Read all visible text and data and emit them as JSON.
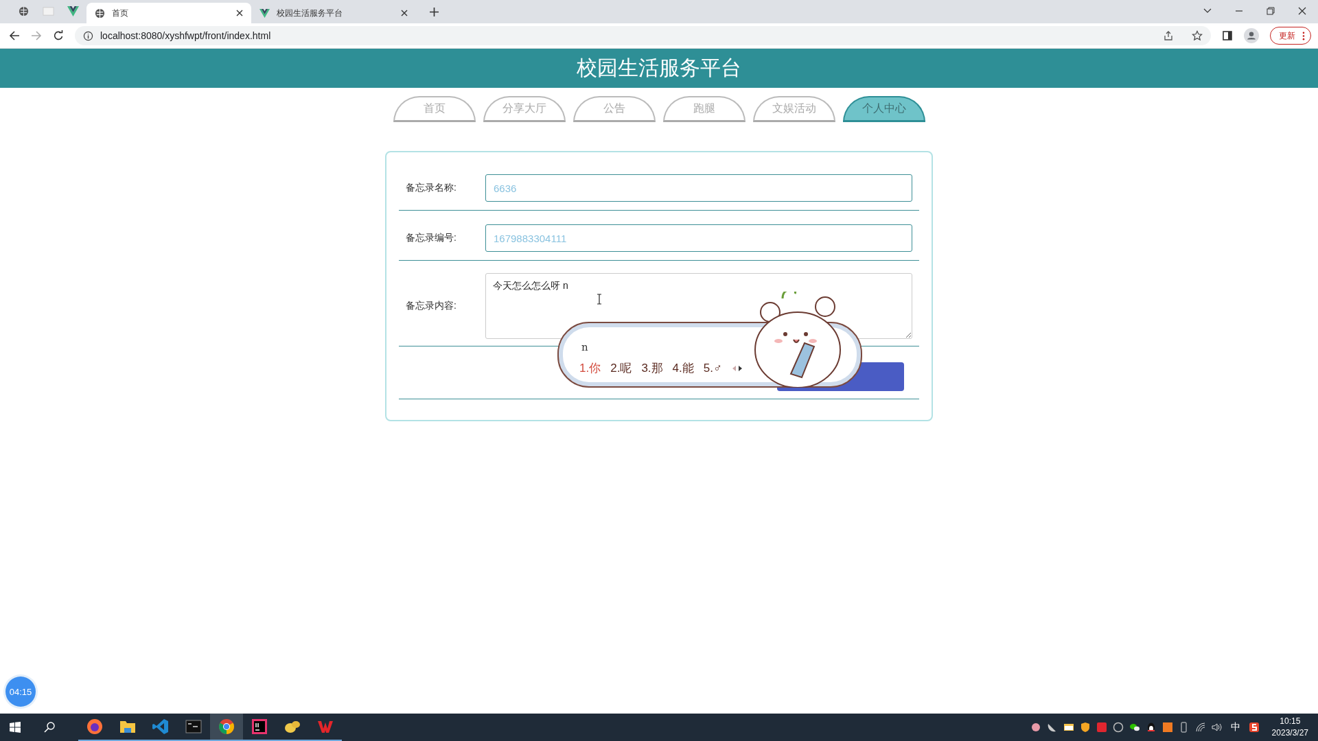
{
  "browser": {
    "tabs": [
      {
        "title": "首页",
        "kind": "globe",
        "selected": true
      },
      {
        "title": "校园生活服务平台",
        "kind": "vue",
        "selected": false
      }
    ],
    "address": "localhost:8080/xyshfwpt/front/index.html",
    "update_button": "更新"
  },
  "header": {
    "title": "校园生活服务平台"
  },
  "nav": [
    {
      "label": "首页",
      "selected": false
    },
    {
      "label": "分享大厅",
      "selected": false
    },
    {
      "label": "公告",
      "selected": false
    },
    {
      "label": "跑腿",
      "selected": false
    },
    {
      "label": "文娱活动",
      "selected": false
    },
    {
      "label": "个人中心",
      "selected": true
    }
  ],
  "form": {
    "fields": [
      {
        "label": "备忘录名称:",
        "kind": "input",
        "value": "6636"
      },
      {
        "label": "备忘录编号:",
        "kind": "input",
        "value": "1679883304111"
      },
      {
        "label": "备忘录内容:",
        "kind": "textarea",
        "value": "今天怎么怎么呀 n"
      }
    ]
  },
  "ime": {
    "composition": "n",
    "candidates": [
      {
        "label": "1.你",
        "selected": true
      },
      {
        "label": "2.呢",
        "selected": false
      },
      {
        "label": "3.那",
        "selected": false
      },
      {
        "label": "4.能",
        "selected": false
      },
      {
        "label": "5.♂",
        "selected": false
      }
    ]
  },
  "timer": "04:15",
  "taskbar": {
    "apps": [
      {
        "kind": "firefox",
        "selected": false
      },
      {
        "kind": "folder",
        "selected": false
      },
      {
        "kind": "vscode",
        "selected": false
      },
      {
        "kind": "terminal",
        "selected": false
      },
      {
        "kind": "chrome",
        "selected": true
      },
      {
        "kind": "idea",
        "selected": false
      },
      {
        "kind": "blob",
        "selected": false
      },
      {
        "kind": "wps",
        "selected": false
      }
    ],
    "input_mode": "中",
    "time": "10:15",
    "date": "2023/3/27"
  }
}
